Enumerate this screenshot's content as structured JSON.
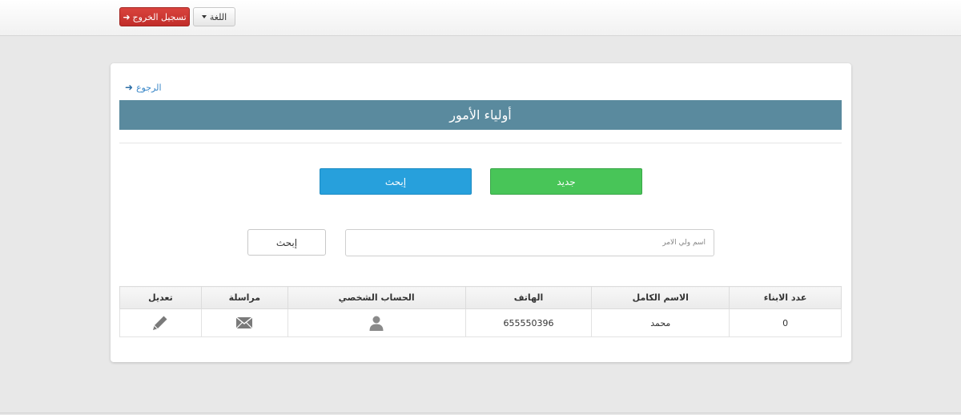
{
  "navbar": {
    "logout_label": "تسجيل الخروج",
    "language_label": "اللغة"
  },
  "page": {
    "back_label": "الرجوع",
    "title": "أولياء الأمور",
    "new_button": "جديد",
    "search_toggle_button": "إبحث",
    "search_placeholder": "اسم ولي الامر",
    "search_button": "إبحث"
  },
  "table": {
    "columns": [
      "عدد الابناء",
      "الاسم الكامل",
      "الهاتف",
      "الحساب الشخصي",
      "مراسلة",
      "تعديل"
    ],
    "rows": [
      {
        "children_count": "0",
        "full_name": "محمد",
        "phone": "655550396",
        "profile_icon": "user-icon",
        "message_icon": "envelope-icon",
        "edit_icon": "pencil-icon"
      }
    ]
  },
  "colors": {
    "header_bar": "#5a8a9e",
    "new_button": "#48c558",
    "search_button": "#27a0dc",
    "logout_button": "#c9302c"
  }
}
